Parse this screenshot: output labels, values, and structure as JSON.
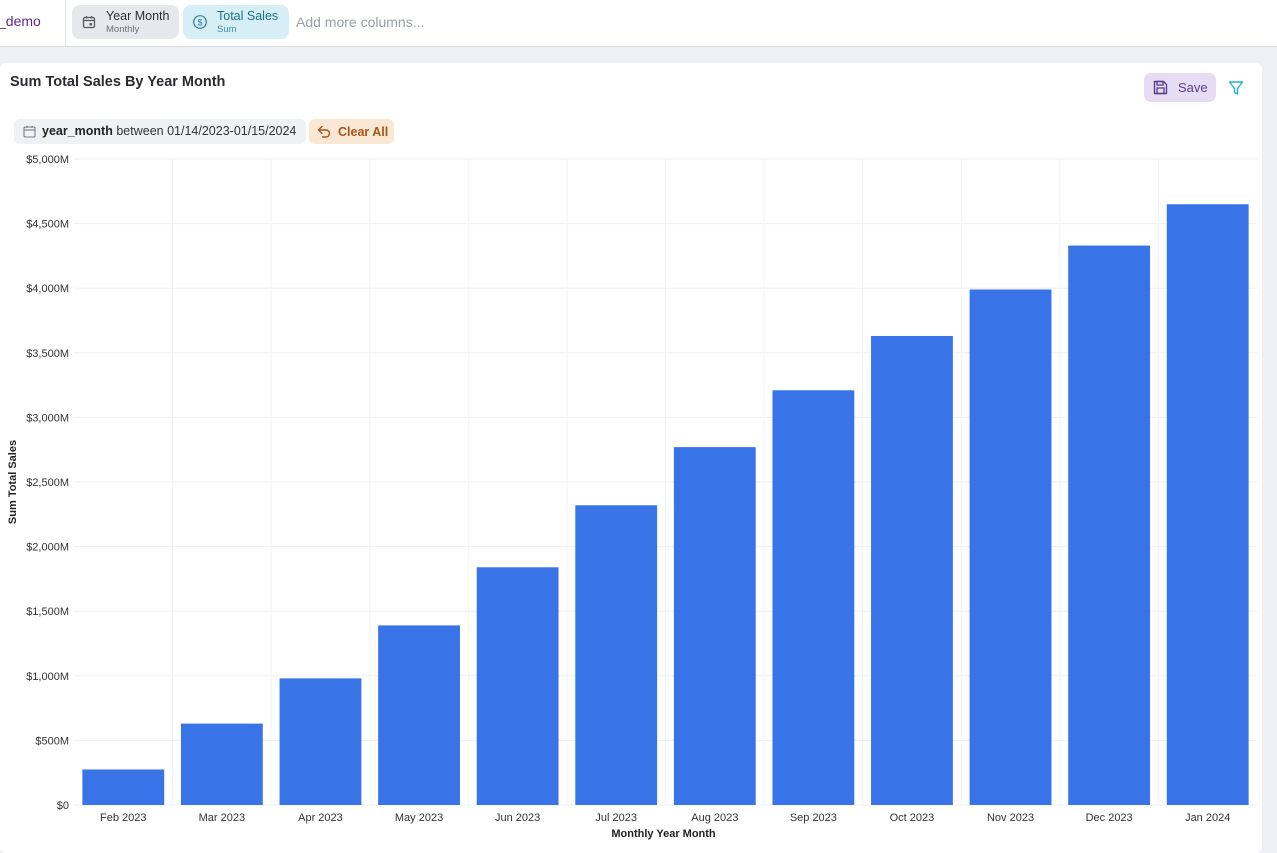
{
  "topbar": {
    "dataset_name": "_demo",
    "chips": [
      {
        "label": "Year Month",
        "sublabel": "Monthly",
        "icon": "calendar-icon"
      },
      {
        "label": "Total Sales",
        "sublabel": "Sum",
        "icon": "dollar-circle-icon"
      }
    ],
    "add_placeholder": "Add more columns..."
  },
  "card": {
    "title": "Sum Total Sales By Year Month",
    "save_label": "Save",
    "filter": {
      "field": "year_month",
      "operator": "between",
      "value": "01/14/2023-01/15/2024"
    },
    "clear_all_label": "Clear All"
  },
  "colors": {
    "bar": "#3874e8",
    "accent_purple": "#5b3d8a",
    "filter_icon": "#1fb3cf"
  },
  "chart_data": {
    "type": "bar",
    "title": "Sum Total Sales By Year Month",
    "xlabel": "Monthly Year Month",
    "ylabel": "Sum Total Sales",
    "categories": [
      "Feb 2023",
      "Mar 2023",
      "Apr 2023",
      "May 2023",
      "Jun 2023",
      "Jul 2023",
      "Aug 2023",
      "Sep 2023",
      "Oct 2023",
      "Nov 2023",
      "Dec 2023",
      "Jan 2024"
    ],
    "values": [
      275,
      630,
      980,
      1390,
      1840,
      2320,
      2770,
      3210,
      3630,
      3990,
      4330,
      4650
    ],
    "value_unit": "$M",
    "ylim": [
      0,
      5000
    ],
    "yticks": [
      0,
      500,
      1000,
      1500,
      2000,
      2500,
      3000,
      3500,
      4000,
      4500,
      5000
    ],
    "ytick_labels": [
      "$0",
      "$500M",
      "$1,000M",
      "$1,500M",
      "$2,000M",
      "$2,500M",
      "$3,000M",
      "$3,500M",
      "$4,000M",
      "$4,500M",
      "$5,000M"
    ],
    "grid": true,
    "legend": "none"
  }
}
